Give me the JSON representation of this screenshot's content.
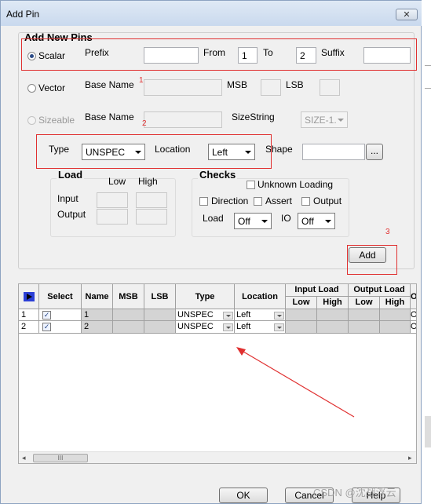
{
  "window": {
    "title": "Add Pin",
    "close": "✕"
  },
  "section": {
    "title": "Add New Pins"
  },
  "scalar": {
    "label": "Scalar",
    "prefix_label": "Prefix",
    "prefix_value": "",
    "from_label": "From",
    "from_value": "1",
    "to_label": "To",
    "to_value": "2",
    "suffix_label": "Suffix",
    "suffix_value": ""
  },
  "vector": {
    "label": "Vector",
    "base_label": "Base Name",
    "base_value": "",
    "msb_label": "MSB",
    "lsb_label": "LSB"
  },
  "sizeable": {
    "label": "Sizeable",
    "base_label": "Base Name",
    "base_value": "",
    "sizestring_label": "SizeString",
    "sizestring_value": "SIZE-1."
  },
  "pin": {
    "type_label": "Type",
    "type_value": "UNSPEC",
    "location_label": "Location",
    "location_value": "Left",
    "shape_label": "Shape",
    "shape_value": "",
    "browse": "..."
  },
  "load": {
    "title": "Load",
    "low": "Low",
    "high": "High",
    "input": "Input",
    "output": "Output"
  },
  "checks": {
    "title": "Checks",
    "unknown_loading": "Unknown Loading",
    "direction": "Direction",
    "assert": "Assert",
    "output": "Output",
    "load_label": "Load",
    "load_value": "Off",
    "io_label": "IO",
    "io_value": "Off"
  },
  "add_button": "Add",
  "annotations": {
    "n1": "1",
    "n2": "2",
    "n3": "3"
  },
  "grid": {
    "headers": {
      "select": "Select",
      "name": "Name",
      "msb": "MSB",
      "lsb": "LSB",
      "type": "Type",
      "location": "Location",
      "input_load": "Input Load",
      "output_load": "Output Load",
      "low": "Low",
      "high": "High",
      "low2": "Low",
      "high2": "High",
      "cut": "O"
    },
    "rows": [
      {
        "num": "1",
        "name": "1",
        "type": "UNSPEC",
        "location": "Left",
        "cut": "O"
      },
      {
        "num": "2",
        "name": "2",
        "type": "UNSPEC",
        "location": "Left",
        "cut": "O"
      }
    ],
    "scroll_thumb": "III"
  },
  "buttons": {
    "ok": "OK",
    "cancel": "Cancel",
    "help": "Help"
  },
  "watermark": "CSDN @沈战浮云",
  "colors": {
    "annotation_red": "#e03030",
    "title_bar": "#c9d9ee",
    "selected_row": "#d4d4d4"
  }
}
